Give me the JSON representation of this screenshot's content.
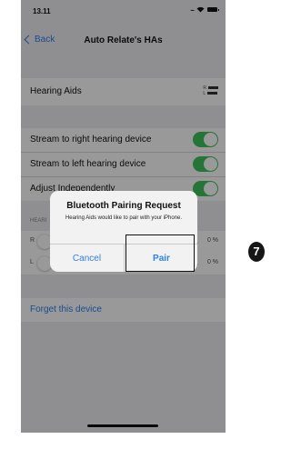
{
  "status_bar": {
    "time": "13.11",
    "icons": [
      "cellular-dots-icon",
      "wifi-icon",
      "battery-icon"
    ]
  },
  "nav": {
    "back_label": "Back",
    "title": "Auto Relate's HAs"
  },
  "device": {
    "name": "Hearing Aids",
    "right_indicator": "R",
    "left_indicator": "L"
  },
  "settings": {
    "stream_right": "Stream to right hearing device",
    "stream_left": "Stream to left hearing device",
    "adjust": "Adjust Independently"
  },
  "hearing_section": {
    "header": "HEARI",
    "sliders": [
      {
        "side": "R",
        "value_label": "0 %",
        "level": 0
      },
      {
        "side": "L",
        "value_label": "0 %",
        "level": 0
      }
    ]
  },
  "forget_label": "Forget this device",
  "alert": {
    "title": "Bluetooth Pairing Request",
    "message": "Hearing Aids would like to pair with your iPhone.",
    "cancel_label": "Cancel",
    "pair_label": "Pair"
  },
  "step_marker": "7",
  "colors": {
    "accent": "#2b80f4",
    "toggle_on": "#3cc45b",
    "background": "#efeff4"
  }
}
